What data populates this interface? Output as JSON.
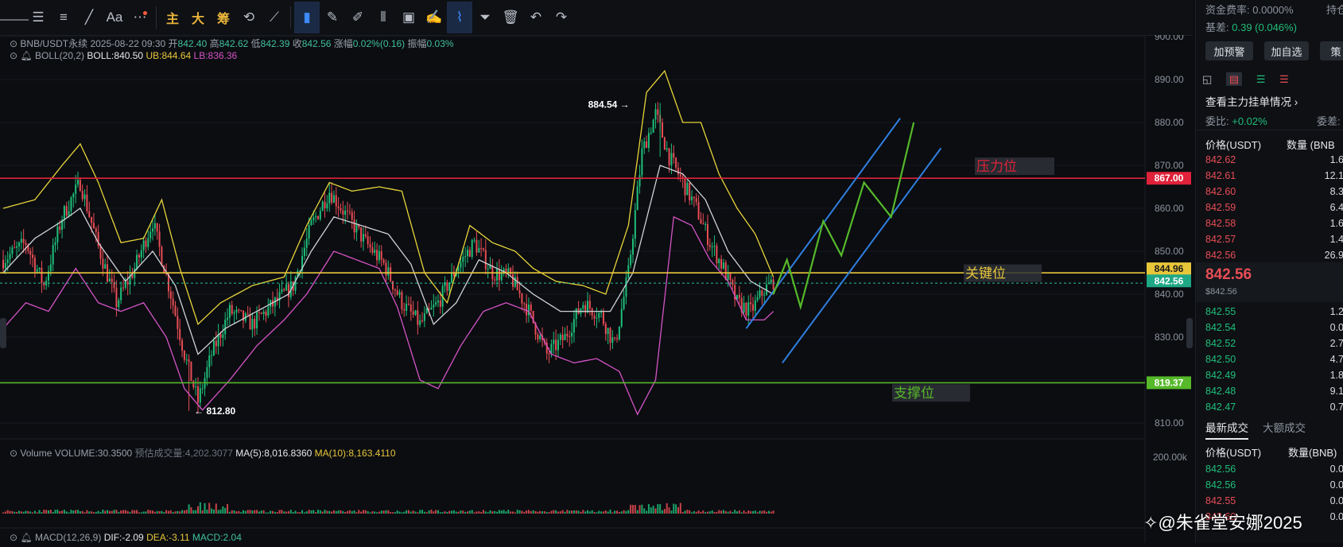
{
  "toolbar": {
    "buttons": [
      {
        "name": "horizontal-line-tool",
        "glyph": "⸻",
        "active": false
      },
      {
        "name": "ray-tool",
        "glyph": "☰",
        "active": false
      },
      {
        "name": "parallel-lines-tool",
        "glyph": "≡",
        "active": false
      },
      {
        "name": "trend-line-tool",
        "glyph": "╱",
        "active": false
      },
      {
        "name": "text-tool",
        "glyph": "Aa",
        "active": false
      },
      {
        "name": "more-tools",
        "glyph": "⋯",
        "active": false
      }
    ],
    "cn_buttons": [
      "主",
      "大",
      "筹"
    ],
    "right_buttons": [
      {
        "name": "indicator-tool",
        "glyph": "⟲",
        "active": false
      },
      {
        "name": "measure-tool",
        "glyph": "⟋",
        "active": false
      },
      {
        "name": "bookmark-tool",
        "glyph": "▮",
        "active": true
      },
      {
        "name": "pen-tool",
        "glyph": "✎",
        "active": false
      },
      {
        "name": "brush-tool",
        "glyph": "✐",
        "active": false
      },
      {
        "name": "candle-tool",
        "glyph": "⫴",
        "active": false
      },
      {
        "name": "clipboard-tool",
        "glyph": "▣",
        "active": false
      },
      {
        "name": "edit-tool",
        "glyph": "✍",
        "active": false
      },
      {
        "name": "magnet-tool",
        "glyph": "⌇",
        "active": true
      },
      {
        "name": "filter-tool",
        "glyph": "⏷",
        "active": false
      },
      {
        "name": "delete-tool",
        "glyph": "🗑",
        "active": false
      },
      {
        "name": "undo-tool",
        "glyph": "↶",
        "active": false
      },
      {
        "name": "redo-tool",
        "glyph": "↷",
        "active": false
      }
    ]
  },
  "legend": {
    "symbol": "BNB/USDT永续",
    "datetime": "2025-08-22 09:30",
    "open_label": "开",
    "open": "842.40",
    "high_label": "高",
    "high": "842.62",
    "low_label": "低",
    "low": "842.39",
    "close_label": "收",
    "close": "842.56",
    "change_label": "涨幅",
    "change": "0.02%(0.16)",
    "amp_label": "振幅",
    "amp": "0.03%",
    "boll_label": "BOLL(20,2)",
    "boll": "BOLL:840.50",
    "ub": "UB:844.64",
    "lb": "LB:836.36",
    "volume_label": "Volume",
    "volume": "VOLUME:30.3500",
    "est_volume": "预估成交量:4,202.3077",
    "ma5": "MA(5):8,016.8360",
    "ma10": "MA(10):8,163.4110",
    "macd_label": "MACD(12,26,9)",
    "dif": "DIF:-2.09",
    "dea": "DEA:-3.11",
    "macd": "MACD:2.04"
  },
  "annotations": {
    "resistance": "压力位",
    "key": "关键位",
    "support": "支撑位",
    "high_mark": "884.54 →",
    "low_mark": "← 812.80"
  },
  "price_tags": {
    "resistance": "867.00",
    "key": "844.96",
    "current": "842.56",
    "support": "819.37"
  },
  "volume_axis_label": "200.00k",
  "chart_data": {
    "type": "candlestick",
    "y_axis_ticks": [
      900,
      890,
      880,
      870,
      860,
      850,
      840,
      830,
      820,
      810
    ],
    "ylim": [
      805.7,
      901
    ],
    "horizontal_lines": [
      {
        "label": "压力位",
        "value": 867.0,
        "color": "#e0223a"
      },
      {
        "label": "关键位",
        "value": 844.96,
        "color": "#e8c63a"
      },
      {
        "label": "支撑位",
        "value": 819.37,
        "color": "#56b92a"
      }
    ],
    "current_price": 842.56,
    "marked_high": 884.54,
    "marked_low": 812.8,
    "close_path": [
      {
        "i": 0,
        "v": 848
      },
      {
        "i": 10,
        "v": 852
      },
      {
        "i": 18,
        "v": 842
      },
      {
        "i": 26,
        "v": 858
      },
      {
        "i": 34,
        "v": 866
      },
      {
        "i": 42,
        "v": 851
      },
      {
        "i": 50,
        "v": 838
      },
      {
        "i": 58,
        "v": 846
      },
      {
        "i": 66,
        "v": 857
      },
      {
        "i": 74,
        "v": 840
      },
      {
        "i": 80,
        "v": 826
      },
      {
        "i": 86,
        "v": 815
      },
      {
        "i": 92,
        "v": 826
      },
      {
        "i": 100,
        "v": 836
      },
      {
        "i": 110,
        "v": 833
      },
      {
        "i": 120,
        "v": 838
      },
      {
        "i": 128,
        "v": 842
      },
      {
        "i": 136,
        "v": 856
      },
      {
        "i": 144,
        "v": 864
      },
      {
        "i": 152,
        "v": 858
      },
      {
        "i": 160,
        "v": 852
      },
      {
        "i": 168,
        "v": 847
      },
      {
        "i": 176,
        "v": 838
      },
      {
        "i": 184,
        "v": 833
      },
      {
        "i": 192,
        "v": 838
      },
      {
        "i": 200,
        "v": 846
      },
      {
        "i": 208,
        "v": 852
      },
      {
        "i": 216,
        "v": 845
      },
      {
        "i": 224,
        "v": 844
      },
      {
        "i": 232,
        "v": 836
      },
      {
        "i": 240,
        "v": 826
      },
      {
        "i": 248,
        "v": 830
      },
      {
        "i": 256,
        "v": 838
      },
      {
        "i": 264,
        "v": 835
      },
      {
        "i": 270,
        "v": 828
      },
      {
        "i": 276,
        "v": 845
      },
      {
        "i": 282,
        "v": 873
      },
      {
        "i": 288,
        "v": 882
      },
      {
        "i": 294,
        "v": 872
      },
      {
        "i": 300,
        "v": 866
      },
      {
        "i": 306,
        "v": 860
      },
      {
        "i": 312,
        "v": 852
      },
      {
        "i": 318,
        "v": 846
      },
      {
        "i": 324,
        "v": 838
      },
      {
        "i": 330,
        "v": 836
      },
      {
        "i": 336,
        "v": 841
      },
      {
        "i": 340,
        "v": 843
      }
    ],
    "upper_band": [
      {
        "i": 0,
        "v": 860
      },
      {
        "i": 14,
        "v": 862
      },
      {
        "i": 26,
        "v": 870
      },
      {
        "i": 34,
        "v": 875
      },
      {
        "i": 42,
        "v": 866
      },
      {
        "i": 52,
        "v": 852
      },
      {
        "i": 62,
        "v": 853
      },
      {
        "i": 70,
        "v": 862
      },
      {
        "i": 78,
        "v": 846
      },
      {
        "i": 86,
        "v": 833
      },
      {
        "i": 96,
        "v": 838
      },
      {
        "i": 110,
        "v": 842
      },
      {
        "i": 124,
        "v": 844
      },
      {
        "i": 134,
        "v": 856
      },
      {
        "i": 144,
        "v": 866
      },
      {
        "i": 154,
        "v": 864
      },
      {
        "i": 166,
        "v": 865
      },
      {
        "i": 176,
        "v": 864
      },
      {
        "i": 186,
        "v": 845
      },
      {
        "i": 196,
        "v": 838
      },
      {
        "i": 206,
        "v": 856
      },
      {
        "i": 216,
        "v": 852
      },
      {
        "i": 226,
        "v": 850
      },
      {
        "i": 234,
        "v": 846
      },
      {
        "i": 244,
        "v": 843
      },
      {
        "i": 256,
        "v": 842
      },
      {
        "i": 266,
        "v": 840
      },
      {
        "i": 276,
        "v": 856
      },
      {
        "i": 284,
        "v": 887
      },
      {
        "i": 292,
        "v": 892
      },
      {
        "i": 300,
        "v": 880
      },
      {
        "i": 308,
        "v": 880
      },
      {
        "i": 316,
        "v": 868
      },
      {
        "i": 324,
        "v": 860
      },
      {
        "i": 332,
        "v": 854
      },
      {
        "i": 340,
        "v": 844
      }
    ],
    "middle_band": [
      {
        "i": 0,
        "v": 845
      },
      {
        "i": 14,
        "v": 853
      },
      {
        "i": 26,
        "v": 857
      },
      {
        "i": 34,
        "v": 860
      },
      {
        "i": 42,
        "v": 852
      },
      {
        "i": 54,
        "v": 843
      },
      {
        "i": 66,
        "v": 850
      },
      {
        "i": 76,
        "v": 842
      },
      {
        "i": 86,
        "v": 826
      },
      {
        "i": 98,
        "v": 832
      },
      {
        "i": 112,
        "v": 836
      },
      {
        "i": 126,
        "v": 840
      },
      {
        "i": 136,
        "v": 850
      },
      {
        "i": 146,
        "v": 858
      },
      {
        "i": 158,
        "v": 856
      },
      {
        "i": 170,
        "v": 854
      },
      {
        "i": 180,
        "v": 847
      },
      {
        "i": 190,
        "v": 833
      },
      {
        "i": 200,
        "v": 838
      },
      {
        "i": 210,
        "v": 848
      },
      {
        "i": 222,
        "v": 845
      },
      {
        "i": 234,
        "v": 840
      },
      {
        "i": 246,
        "v": 836
      },
      {
        "i": 258,
        "v": 836
      },
      {
        "i": 268,
        "v": 836
      },
      {
        "i": 278,
        "v": 845
      },
      {
        "i": 290,
        "v": 870
      },
      {
        "i": 300,
        "v": 868
      },
      {
        "i": 310,
        "v": 862
      },
      {
        "i": 320,
        "v": 850
      },
      {
        "i": 330,
        "v": 843
      },
      {
        "i": 340,
        "v": 840
      }
    ],
    "lower_band": [
      {
        "i": 0,
        "v": 832
      },
      {
        "i": 10,
        "v": 838
      },
      {
        "i": 20,
        "v": 836
      },
      {
        "i": 32,
        "v": 846
      },
      {
        "i": 42,
        "v": 838
      },
      {
        "i": 52,
        "v": 836
      },
      {
        "i": 62,
        "v": 838
      },
      {
        "i": 72,
        "v": 830
      },
      {
        "i": 80,
        "v": 818
      },
      {
        "i": 88,
        "v": 813
      },
      {
        "i": 100,
        "v": 820
      },
      {
        "i": 112,
        "v": 828
      },
      {
        "i": 124,
        "v": 834
      },
      {
        "i": 134,
        "v": 840
      },
      {
        "i": 146,
        "v": 850
      },
      {
        "i": 156,
        "v": 848
      },
      {
        "i": 166,
        "v": 846
      },
      {
        "i": 174,
        "v": 837
      },
      {
        "i": 184,
        "v": 820
      },
      {
        "i": 192,
        "v": 818
      },
      {
        "i": 202,
        "v": 828
      },
      {
        "i": 212,
        "v": 836
      },
      {
        "i": 222,
        "v": 838
      },
      {
        "i": 232,
        "v": 836
      },
      {
        "i": 242,
        "v": 826
      },
      {
        "i": 252,
        "v": 824
      },
      {
        "i": 262,
        "v": 825
      },
      {
        "i": 272,
        "v": 822
      },
      {
        "i": 280,
        "v": 812
      },
      {
        "i": 288,
        "v": 820
      },
      {
        "i": 296,
        "v": 858
      },
      {
        "i": 304,
        "v": 856
      },
      {
        "i": 312,
        "v": 848
      },
      {
        "i": 320,
        "v": 843
      },
      {
        "i": 328,
        "v": 834
      },
      {
        "i": 336,
        "v": 834
      },
      {
        "i": 340,
        "v": 836
      }
    ],
    "projection_zigzag": [
      {
        "i": 340,
        "v": 840
      },
      {
        "i": 346,
        "v": 848
      },
      {
        "i": 352,
        "v": 837
      },
      {
        "i": 362,
        "v": 857
      },
      {
        "i": 370,
        "v": 849
      },
      {
        "i": 380,
        "v": 866
      },
      {
        "i": 392,
        "v": 858
      },
      {
        "i": 402,
        "v": 880
      }
    ],
    "channel_lines": [
      {
        "from": {
          "i": 328,
          "v": 832
        },
        "to": {
          "i": 396,
          "v": 881
        }
      },
      {
        "from": {
          "i": 344,
          "v": 824
        },
        "to": {
          "i": 414,
          "v": 874
        }
      }
    ],
    "macd_value": "MACD:2.04"
  },
  "right_panel": {
    "funding_label": "资金费率:",
    "funding": "0.0000%",
    "hold_label": "持仓",
    "basis_label": "基差:",
    "basis": "0.39 (0.046%)",
    "btn_alert": "加预警",
    "btn_fav": "加自选",
    "btn_strategy": "策",
    "orders_title": "查看主力挂单情况",
    "ratio_label": "委比:",
    "ratio": "+0.02%",
    "diff_label": "委差:",
    "col_price": "价格(USDT)",
    "col_qty": "数量 (BNB",
    "asks": [
      {
        "p": "842.62",
        "q": "1.6"
      },
      {
        "p": "842.61",
        "q": "12.1"
      },
      {
        "p": "842.60",
        "q": "8.3"
      },
      {
        "p": "842.59",
        "q": "6.4"
      },
      {
        "p": "842.58",
        "q": "1.6"
      },
      {
        "p": "842.57",
        "q": "1.4"
      },
      {
        "p": "842.56",
        "q": "26.9"
      }
    ],
    "last_price": "842.56",
    "last_price_sub": "$842.56",
    "bids": [
      {
        "p": "842.55",
        "q": "1.2"
      },
      {
        "p": "842.54",
        "q": "0.0"
      },
      {
        "p": "842.52",
        "q": "2.7"
      },
      {
        "p": "842.50",
        "q": "4.7"
      },
      {
        "p": "842.49",
        "q": "1.8"
      },
      {
        "p": "842.48",
        "q": "9.1"
      },
      {
        "p": "842.47",
        "q": "0.7"
      }
    ],
    "tab_latest": "最新成交",
    "tab_large": "大额成交",
    "trade_col_price": "价格(USDT)",
    "trade_col_qty": "数量(BNB)",
    "trades": [
      {
        "p": "842.56",
        "q": "0.0",
        "side": "buy"
      },
      {
        "p": "842.56",
        "q": "0.0",
        "side": "buy"
      },
      {
        "p": "842.55",
        "q": "0.0",
        "side": "sell"
      },
      {
        "p": "842.60",
        "q": "0.0",
        "side": "sell"
      }
    ]
  },
  "watermark": "@朱雀堂安娜2025"
}
